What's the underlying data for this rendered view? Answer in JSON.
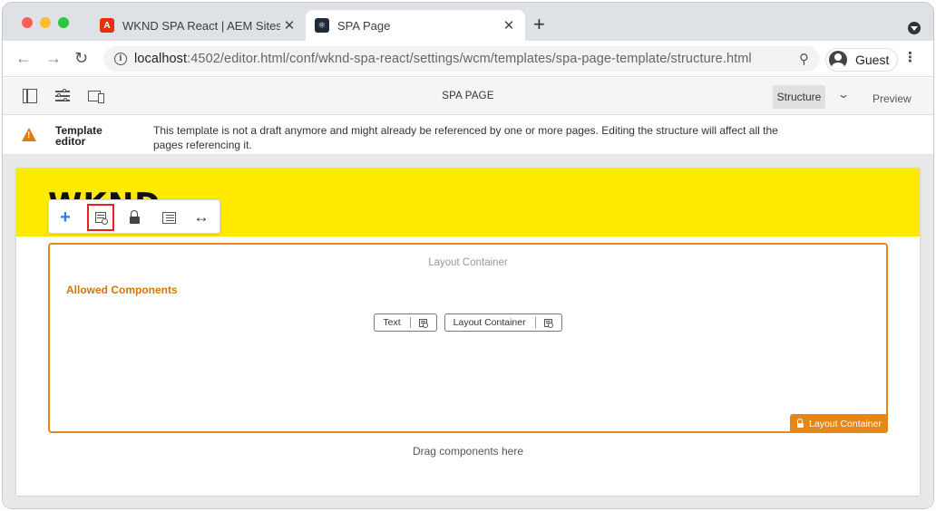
{
  "browser": {
    "tabs": [
      {
        "title": "WKND SPA React | AEM Sites |",
        "favicon": "adobe-icon",
        "active": false
      },
      {
        "title": "SPA Page",
        "favicon": "react-icon",
        "active": true
      }
    ],
    "address": {
      "host": "localhost",
      "path": ":4502/editor.html/conf/wknd-spa-react/settings/wcm/templates/spa-page-template/structure.html"
    },
    "profile_label": "Guest"
  },
  "editor": {
    "page_title": "SPA PAGE",
    "mode_selected": "Structure",
    "preview_label": "Preview"
  },
  "alert": {
    "title": "Template editor",
    "message": "This template is not a draft anymore and might already be referenced by one or more pages. Editing the structure will affect all the pages referencing it."
  },
  "canvas": {
    "logo": "WKND",
    "layout_container_title": "Layout Container",
    "allowed_components_label": "Allowed Components",
    "allowed_components": [
      {
        "label": "Text"
      },
      {
        "label": "Layout Container"
      }
    ],
    "badge_label": "Layout Container",
    "drag_hint": "Drag components here"
  },
  "colors": {
    "header_yellow": "#ffea00",
    "accent_orange": "#e68619",
    "highlight_red": "#e4221f"
  }
}
